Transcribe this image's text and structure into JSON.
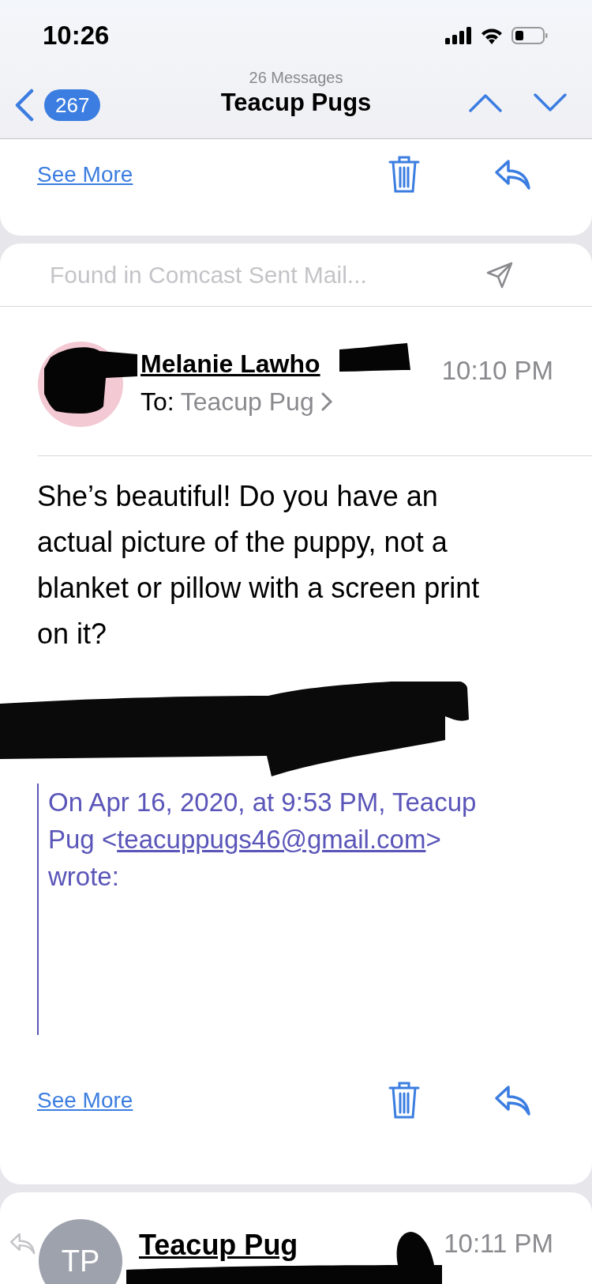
{
  "status_bar": {
    "time": "10:26"
  },
  "nav": {
    "back_count": "267",
    "subtitle": "26 Messages",
    "title": "Teacup Pugs"
  },
  "top_card": {
    "see_more": "See More"
  },
  "message": {
    "found_in": "Found in Comcast Sent Mail...",
    "sender": "Melanie Lawho",
    "time": "10:10 PM",
    "to_label": "To:",
    "recipient": "Teacup Pug",
    "body": "She’s beautiful! Do you have an actual picture of the puppy, not a blanket or pillow with a screen print on it?",
    "quote": {
      "before": "On Apr 16, 2020, at 9:53 PM, Teacup Pug <",
      "link": "teacuppugs46@gmail.com",
      "after": "> wrote:"
    },
    "see_more": "See More"
  },
  "next_message": {
    "initials": "TP",
    "sender": "Teacup Pug",
    "time": "10:11 PM",
    "replied": true
  }
}
